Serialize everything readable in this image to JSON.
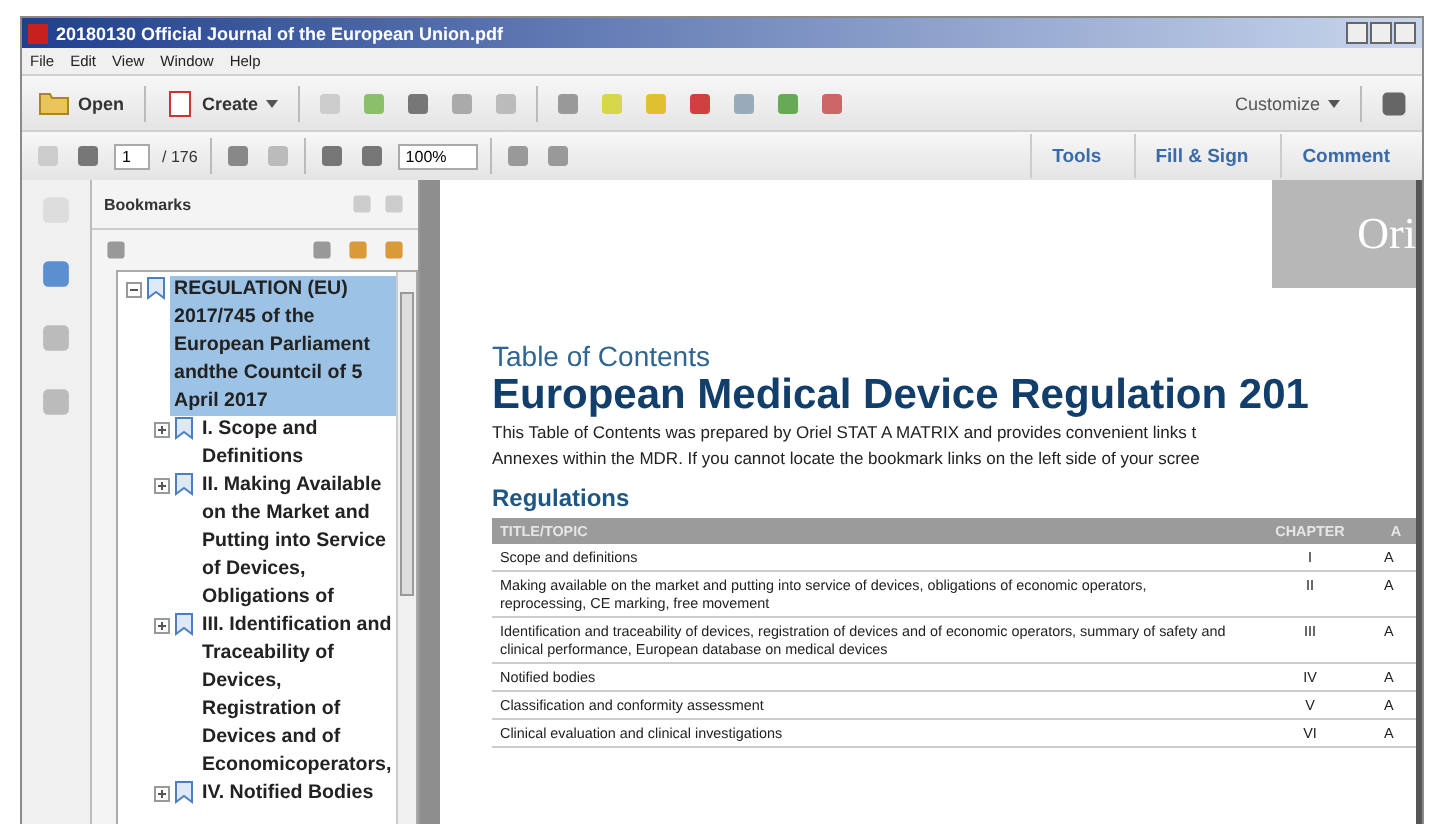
{
  "window": {
    "title": "20180130 Official Journal of the European Union.pdf"
  },
  "menu": [
    "File",
    "Edit",
    "View",
    "Window",
    "Help"
  ],
  "toolbar": {
    "open": "Open",
    "create": "Create",
    "customize": "Customize"
  },
  "navbar": {
    "page": "1",
    "total": "/ 176",
    "zoom": "100%",
    "panels": [
      "Tools",
      "Fill & Sign",
      "Comment"
    ]
  },
  "bookmarks": {
    "title": "Bookmarks",
    "items": [
      {
        "label": "REGULATION (EU) 2017/745 of the European Parliament andthe Countcil of 5 April 2017",
        "selected": true,
        "expanded": true,
        "children": [
          {
            "label": "I. Scope and Definitions",
            "selected": false,
            "expanded": false
          },
          {
            "label": "II. Making Available on the Market and Putting into Service of Devices, Obligations of",
            "selected": false,
            "expanded": false
          },
          {
            "label": "III. Identification and Traceability of Devices, Registration of Devices and of Economicoperators,",
            "selected": false,
            "expanded": false
          },
          {
            "label": "IV. Notified Bodies",
            "selected": false,
            "expanded": false
          }
        ]
      }
    ]
  },
  "document": {
    "logo": "Ori",
    "subtitle": "Table of Contents",
    "title": "European Medical Device Regulation 201",
    "intro": [
      "This Table of Contents was prepared by Oriel STAT A MATRIX and provides convenient links t",
      "Annexes within the MDR. If you cannot locate the bookmark links on the left side of your scree"
    ],
    "section": "Regulations",
    "table": {
      "columns": [
        "TITLE/TOPIC",
        "CHAPTER",
        "A"
      ],
      "rows": [
        [
          "Scope and definitions",
          "I",
          "A"
        ],
        [
          "Making available on the market and putting into service of devices, obligations of economic operators, reprocessing, CE marking, free movement",
          "II",
          "A"
        ],
        [
          "Identification and traceability of devices, registration of devices and of economic operators, summary of safety and clinical performance, European database on medical devices",
          "III",
          "A"
        ],
        [
          "Notified bodies",
          "IV",
          "A"
        ],
        [
          "Classification and conformity assessment",
          "V",
          "A"
        ],
        [
          "Clinical evaluation and clinical investigations",
          "VI",
          "A"
        ]
      ]
    }
  }
}
